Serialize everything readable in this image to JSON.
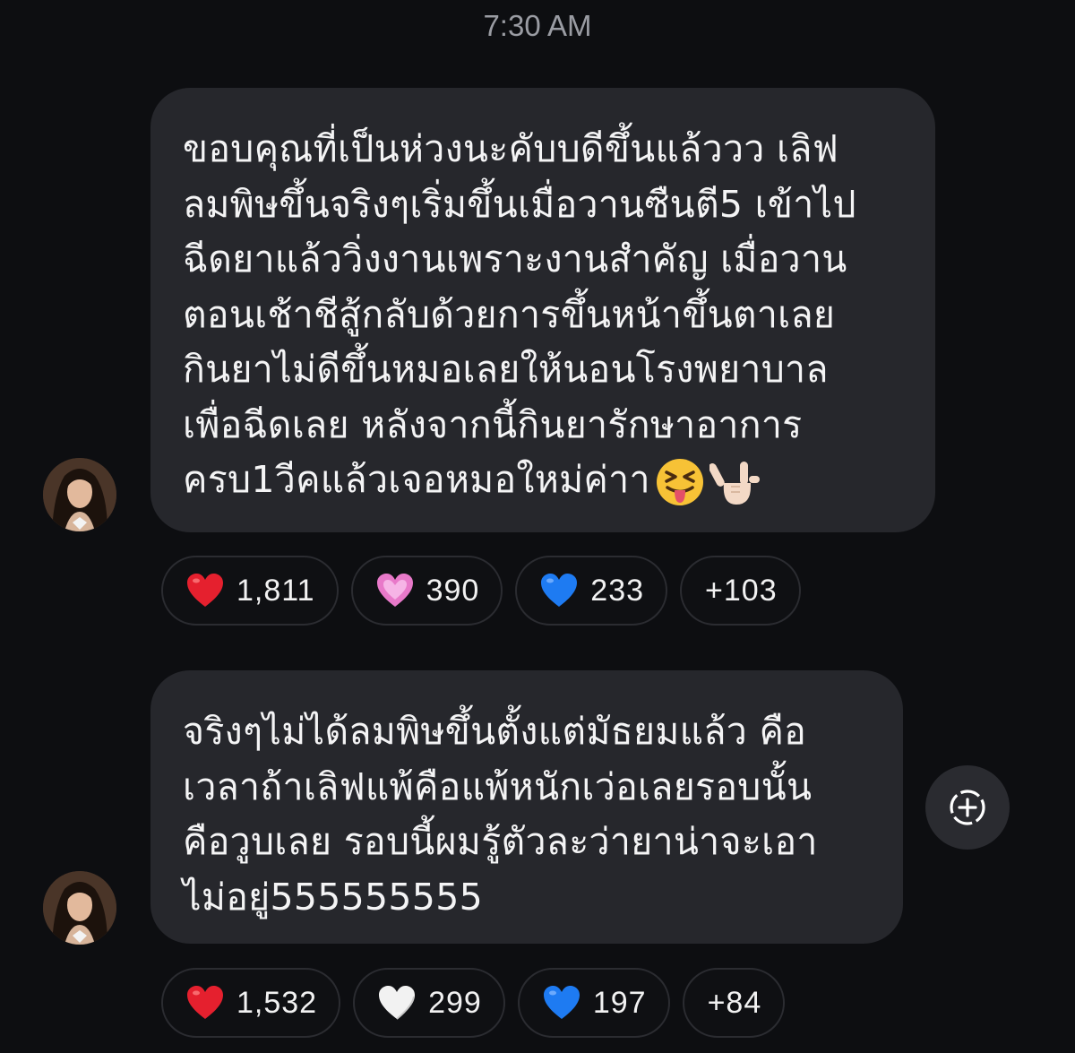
{
  "timestamp": "7:30 AM",
  "messages": [
    {
      "lines": [
        "ขอบคุณที่เป็นห่วงนะคับบดีขึ้นแล้ววว เลิฟ",
        "ลมพิษขึ้นจริงๆเริ่มขึ้นเมื่อวานซืนตี5 เข้าไป",
        "ฉีดยาแล้ววิ่งงานเพราะงานสำคัญ เมื่อวาน",
        "ตอนเช้าชีสู้กลับด้วยการขึ้นหน้าขึ้นตาเลย",
        "กินยาไม่ดีขึ้นหมอเลยให้นอนโรงพยาบาล",
        "เพื่อฉีดเลย หลังจากนี้กินยารักษาอาการ",
        "ครบ1วีคแล้วเจอหมอใหม่ค่าา"
      ],
      "trailing_emojis": [
        "squinting-tongue-emoji",
        "love-you-gesture-emoji"
      ],
      "reactions": [
        {
          "emoji": "red-heart",
          "color": "#e5202e",
          "count": "1,811"
        },
        {
          "emoji": "pink-heart",
          "color": "#e879c9",
          "count": "390"
        },
        {
          "emoji": "blue-heart",
          "color": "#1e7bf2",
          "count": "233"
        },
        {
          "emoji": "",
          "color": "",
          "count": "+103"
        }
      ]
    },
    {
      "lines": [
        "จริงๆไม่ได้ลมพิษขึ้นตั้งแต่มัธยมแล้ว คือ",
        "เวลาถ้าเลิฟแพ้คือแพ้หนักเว่อเลยรอบนั้น",
        "คือวูบเลย รอบนี้ผมรู้ตัวละว่ายาน่าจะเอา",
        "ไม่อยู่555555555"
      ],
      "trailing_emojis": [],
      "reactions": [
        {
          "emoji": "red-heart",
          "color": "#e5202e",
          "count": "1,532"
        },
        {
          "emoji": "white-heart",
          "color": "#f2f2f2",
          "count": "299"
        },
        {
          "emoji": "blue-heart",
          "color": "#1e7bf2",
          "count": "197"
        },
        {
          "emoji": "",
          "color": "",
          "count": "+84"
        }
      ]
    }
  ],
  "colors": {
    "background": "#0d0e11",
    "bubble": "#26272c",
    "timestamp": "#9a9ca3",
    "pill_border": "#2b2c31"
  },
  "icons": {
    "add_reaction": "add-reaction-icon",
    "avatar": "profile-avatar"
  }
}
